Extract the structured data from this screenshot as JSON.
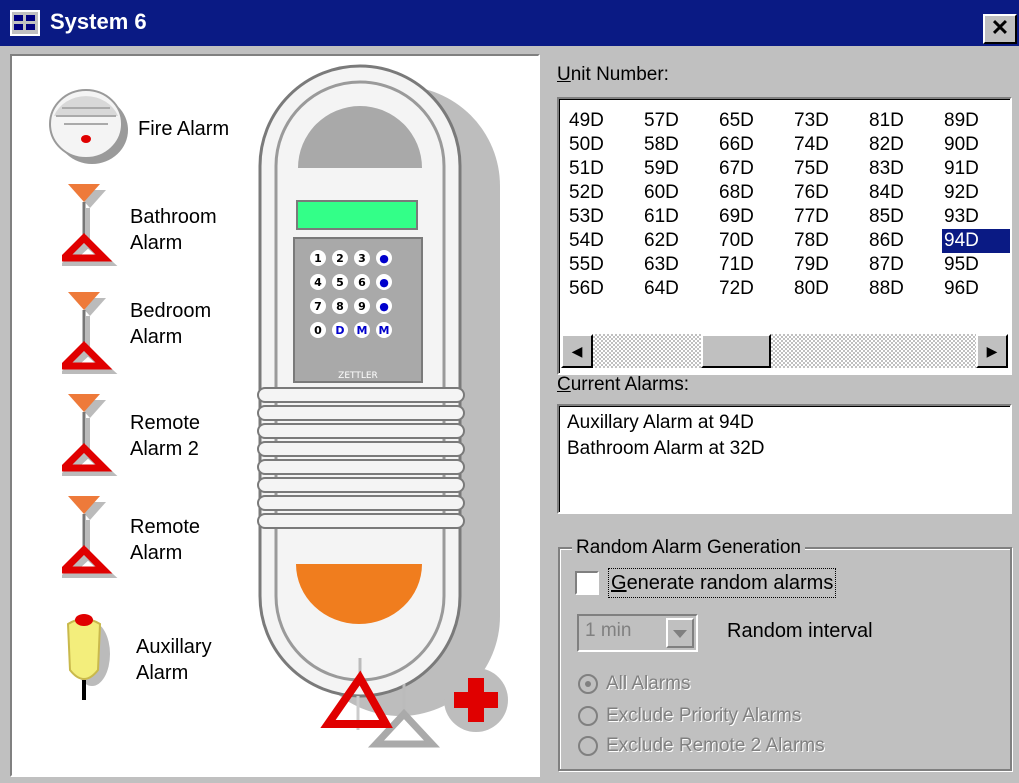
{
  "window": {
    "title": "System 6",
    "close_glyph": "✕"
  },
  "left_panel": {
    "alarms": [
      {
        "id": "fire",
        "label": "Fire Alarm",
        "icon": "smoke-detector-icon"
      },
      {
        "id": "bathroom",
        "label_lines": [
          "Bathroom",
          "Alarm"
        ],
        "icon": "pull-cord-alarm-icon"
      },
      {
        "id": "bedroom",
        "label_lines": [
          "Bedroom",
          "Alarm"
        ],
        "icon": "pull-cord-alarm-icon"
      },
      {
        "id": "remote2",
        "label_lines": [
          "Remote",
          "Alarm 2"
        ],
        "icon": "pull-cord-alarm-icon"
      },
      {
        "id": "remote",
        "label_lines": [
          "Remote",
          "Alarm"
        ],
        "icon": "pull-cord-alarm-icon"
      },
      {
        "id": "auxillary",
        "label_lines": [
          "Auxillary",
          "Alarm"
        ],
        "icon": "pendant-alarm-icon"
      }
    ],
    "unit_device": {
      "keypad": [
        "1",
        "2",
        "3",
        "4",
        "5",
        "6",
        "7",
        "8",
        "9",
        "0",
        "D",
        "M"
      ],
      "brand": "ZETTLER",
      "icon": "intercom-unit-icon"
    },
    "bottom_icons": [
      "pull-triangle-red-icon",
      "pull-triangle-white-icon",
      "red-cross-icon"
    ]
  },
  "unit_number": {
    "label": "Unit Number:",
    "label_mnemonic": "U",
    "label_rest": "nit Number:",
    "columns": [
      [
        "49D",
        "50D",
        "51D",
        "52D",
        "53D",
        "54D",
        "55D",
        "56D"
      ],
      [
        "57D",
        "58D",
        "59D",
        "60D",
        "61D",
        "62D",
        "63D",
        "64D"
      ],
      [
        "65D",
        "66D",
        "67D",
        "68D",
        "69D",
        "70D",
        "71D",
        "72D"
      ],
      [
        "73D",
        "74D",
        "75D",
        "76D",
        "77D",
        "78D",
        "79D",
        "80D"
      ],
      [
        "81D",
        "82D",
        "83D",
        "84D",
        "85D",
        "86D",
        "87D",
        "88D"
      ],
      [
        "89D",
        "90D",
        "91D",
        "92D",
        "93D",
        "94D",
        "95D",
        "96D"
      ]
    ],
    "selected": "94D",
    "scroll_left_glyph": "◀",
    "scroll_right_glyph": "▶"
  },
  "current_alarms": {
    "label_mnemonic": "C",
    "label_rest": "urrent Alarms:",
    "items": [
      "Auxillary Alarm at 94D",
      "Bathroom Alarm at 32D"
    ]
  },
  "random_alarm": {
    "group_label": "Random Alarm Generation",
    "checkbox_mnemonic": "G",
    "checkbox_rest": "enerate random alarms",
    "checkbox_checked": false,
    "interval_value": "1 min",
    "interval_label": "Random interval",
    "radio_options": [
      {
        "label": "All Alarms",
        "selected": true
      },
      {
        "label": "Exclude Priority Alarms",
        "selected": false
      },
      {
        "label": "Exclude Remote 2 Alarms",
        "selected": false
      }
    ]
  }
}
